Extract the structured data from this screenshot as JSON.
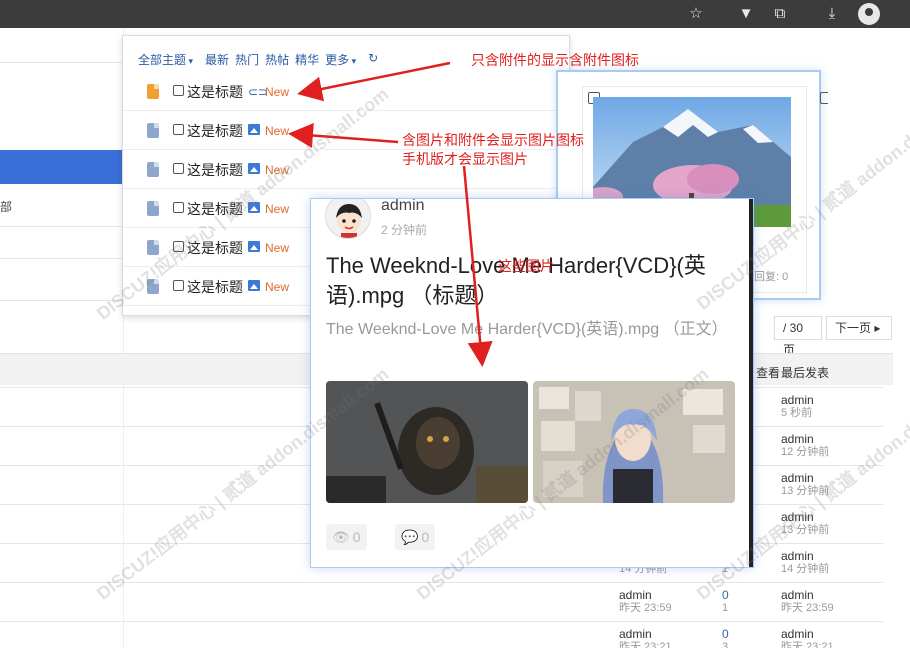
{
  "browser": {
    "icons": [
      "star-icon",
      "vpn-icon",
      "extension-icon",
      "download-icon",
      "profile-icon"
    ]
  },
  "page": {
    "left_label": "部",
    "pager": {
      "total": "/ 30 页",
      "next": "下一页"
    },
    "columns": {
      "view": "查看",
      "last_post": "最后发表"
    },
    "rows": [
      {
        "last_user": "admin",
        "last_time": "5 秒前"
      },
      {
        "last_user": "admin",
        "last_time": "12 分钟前"
      },
      {
        "last_user": "admin",
        "last_time": "13 分钟前"
      },
      {
        "last_user": "admin",
        "last_time": "13 分钟前"
      },
      {
        "author_time": "14 分钟前",
        "views": "1",
        "last_user": "admin",
        "last_time": "14 分钟前"
      },
      {
        "author": "admin",
        "author_time": "昨天 23:59",
        "replies": "0",
        "views": "1",
        "last_user": "admin",
        "last_time": "昨天 23:59"
      },
      {
        "author": "admin",
        "author_time": "昨天 23:21",
        "replies": "0",
        "views": "3",
        "last_user": "admin",
        "last_time": "昨天 23:21"
      }
    ]
  },
  "popup": {
    "nav": [
      "全部主题",
      "最新",
      "热门",
      "热帖",
      "精华",
      "更多"
    ],
    "refresh_icon": "refresh-icon",
    "rows": [
      {
        "title": "这是标题",
        "badge": "New",
        "icon": "attachment",
        "file_color": "#f0a030"
      },
      {
        "title": "这是标题",
        "badge": "New",
        "icon": "image",
        "file_color": "#8fa6cc"
      },
      {
        "title": "这是标题",
        "badge": "New",
        "icon": "image",
        "file_color": "#8fa6cc"
      },
      {
        "title": "这是标题",
        "badge": "New",
        "icon": "image",
        "file_color": "#8fa6cc"
      },
      {
        "title": "这是标题",
        "badge": "New",
        "icon": "image",
        "file_color": "#8fa6cc"
      },
      {
        "title": "这是标题",
        "badge": "New",
        "icon": "image",
        "file_color": "#8fa6cc"
      }
    ]
  },
  "card1": {
    "reply": "回复: 0"
  },
  "card2": {
    "user": "admin",
    "time": "2 分钟前",
    "title": "The Weeknd-Love Me Harder{VCD}(英语).mpg （标题）",
    "desc": "The Weeknd-Love Me Harder{VCD}(英语).mpg （正文）",
    "views": "0",
    "replies": "0"
  },
  "annotations": {
    "a1": "只含附件的显示含附件图标",
    "a2_line1": "含图片和附件会显示图片图标",
    "a2_line2": "手机版才会显示图片",
    "a3": "这些图片"
  },
  "watermark": "DISCUZ!应用中心 | 贰道 addon.dismall.com",
  "colors": {
    "accent": "#2b5ba6",
    "new_badge": "#e06a2e",
    "annotation": "#e0201e",
    "card_border": "#a9cbf2"
  }
}
